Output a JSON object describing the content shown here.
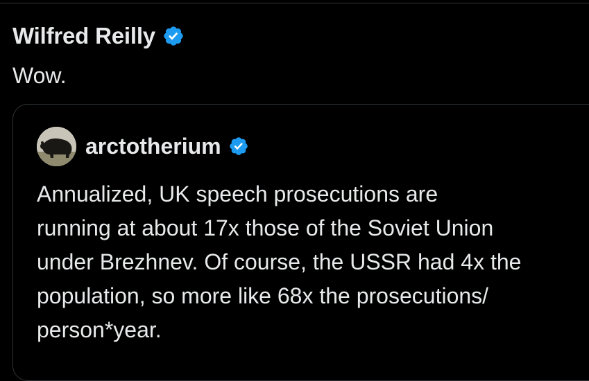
{
  "post": {
    "author_name": "Wilfred Reilly",
    "text": "Wow.",
    "verified_icon": "verified-badge-icon"
  },
  "quoted_post": {
    "author_name": "arctotherium",
    "verified_icon": "verified-badge-icon",
    "avatar": "bear-avatar",
    "lines": [
      "Annualized, UK speech prosecutions are",
      "running at about 17x those of the Soviet Union",
      "under Brezhnev. Of course, the USSR had 4x the",
      "population, so more like 68x the prosecutions/",
      "person*year."
    ]
  },
  "colors": {
    "background": "#000000",
    "text": "#e7e9ea",
    "border": "#2f3336",
    "verified_blue": "#1d9bf0"
  }
}
